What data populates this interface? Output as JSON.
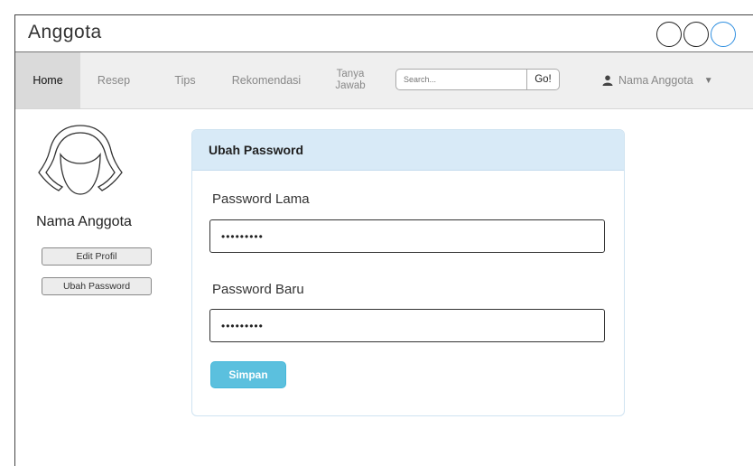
{
  "window": {
    "title": "Anggota"
  },
  "nav": {
    "items": [
      {
        "label": "Home",
        "active": true
      },
      {
        "label": "Resep"
      },
      {
        "label": "Tips"
      },
      {
        "label": "Rekomendasi"
      },
      {
        "label_line1": "Tanya",
        "label_line2": "Jawab"
      }
    ],
    "search_placeholder": "Search...",
    "search_button": "Go!",
    "user_name": "Nama Anggota",
    "caret": "▼"
  },
  "sidebar": {
    "name": "Nama Anggota",
    "edit_profile": "Edit Profil",
    "change_password": "Ubah Password"
  },
  "form": {
    "title": "Ubah Password",
    "old_password_label": "Password Lama",
    "old_password_value": "•••••••••",
    "new_password_label": "Password Baru",
    "new_password_value": "•••••••••",
    "save_button": "Simpan"
  },
  "colors": {
    "accent": "#5bc0de",
    "card_header": "#d8eaf7",
    "nav_bg": "#efefef",
    "active_tab": "#dadada"
  }
}
